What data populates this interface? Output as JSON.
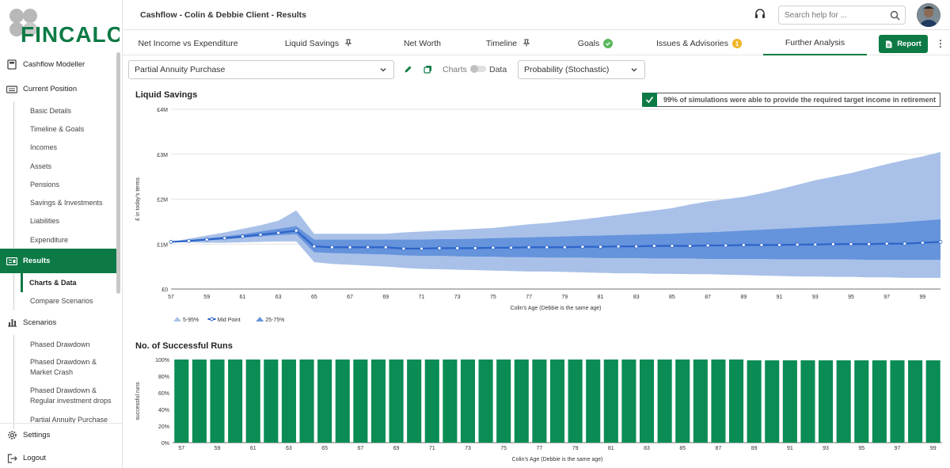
{
  "brand": {
    "logo_text": "FINCALC",
    "accent": "#0d7a45"
  },
  "header": {
    "title": "Cashflow - Colin & Debbie Client - Results",
    "search_placeholder": "Search help for ..."
  },
  "sidebar": {
    "items": [
      {
        "label": "Cashflow Modeller",
        "icon": "calculator-icon"
      },
      {
        "label": "Current Position",
        "icon": "keyboard-icon"
      }
    ],
    "current_position_sub": [
      "Basic Details",
      "Timeline & Goals",
      "Incomes",
      "Assets",
      "Pensions",
      "Savings & Investments",
      "Liabilities",
      "Expenditure"
    ],
    "results": {
      "label": "Results",
      "icon": "results-icon"
    },
    "results_sub": [
      "Charts & Data",
      "Compare Scenarios"
    ],
    "scenarios": {
      "label": "Scenarios",
      "icon": "bar-chart-icon"
    },
    "scenarios_sub": [
      "Phased Drawdown",
      "Phased Drawdown & Market Crash",
      "Phased Drawdown & Regular investment drops",
      "Partial Annuity Purchase"
    ],
    "settings": "Settings",
    "logout": "Logout"
  },
  "tabs": [
    {
      "label": "Net Income vs Expenditure"
    },
    {
      "label": "Liquid Savings",
      "pinned": true
    },
    {
      "label": "Net Worth"
    },
    {
      "label": "Timeline",
      "pinned": true
    },
    {
      "label": "Goals",
      "badge": "check"
    },
    {
      "label": "Issues & Advisories",
      "badge": "1"
    },
    {
      "label": "Further Analysis",
      "active": true
    }
  ],
  "report_label": "Report",
  "toolbar": {
    "scenario": "Partial Annuity Purchase",
    "charts_label": "Charts",
    "data_label": "Data",
    "mode": "Probability (Stochastic)"
  },
  "chart1": {
    "title": "Liquid Savings",
    "banner": "99% of simulations were able to provide the required target income in retirement"
  },
  "chart2": {
    "title": "No. of Successful Runs"
  },
  "chart_data": [
    {
      "type": "area",
      "title": "Liquid Savings",
      "xlabel": "Colin's Age (Debbie is the same age)",
      "ylabel": "£ in today's terms",
      "yticks": [
        "£0",
        "£1M",
        "£2M",
        "£3M",
        "£4M"
      ],
      "ylim": [
        0,
        4000000
      ],
      "xlim": [
        57,
        100
      ],
      "x_tick_labels": [
        57,
        59,
        61,
        63,
        65,
        67,
        69,
        71,
        73,
        75,
        77,
        79,
        81,
        83,
        85,
        87,
        89,
        91,
        93,
        95,
        97,
        99
      ],
      "legend": [
        "5-95%",
        "Mid Point",
        "25-75%"
      ],
      "legend_position": "bottom-left",
      "x": [
        57,
        58,
        59,
        60,
        61,
        62,
        63,
        64,
        65,
        66,
        67,
        68,
        69,
        70,
        71,
        72,
        73,
        74,
        75,
        76,
        77,
        78,
        79,
        80,
        81,
        82,
        83,
        84,
        85,
        86,
        87,
        88,
        89,
        90,
        91,
        92,
        93,
        94,
        95,
        96,
        97,
        98,
        99,
        100
      ],
      "series": [
        {
          "name": "Mid Point",
          "values": [
            1.05,
            1.07,
            1.1,
            1.13,
            1.17,
            1.21,
            1.25,
            1.3,
            0.95,
            0.93,
            0.93,
            0.93,
            0.93,
            0.9,
            0.9,
            0.91,
            0.91,
            0.91,
            0.92,
            0.92,
            0.93,
            0.93,
            0.93,
            0.94,
            0.94,
            0.95,
            0.95,
            0.96,
            0.96,
            0.96,
            0.97,
            0.97,
            0.98,
            0.98,
            0.98,
            0.99,
            0.99,
            1.0,
            1.0,
            1.0,
            1.01,
            1.01,
            1.03,
            1.05
          ],
          "unit": "£M"
        },
        {
          "name": "25-75%",
          "low": [
            1.05,
            1.07,
            1.09,
            1.11,
            1.14,
            1.17,
            1.2,
            1.22,
            0.82,
            0.8,
            0.79,
            0.78,
            0.77,
            0.75,
            0.74,
            0.74,
            0.73,
            0.72,
            0.72,
            0.71,
            0.71,
            0.7,
            0.7,
            0.7,
            0.69,
            0.69,
            0.69,
            0.68,
            0.68,
            0.68,
            0.67,
            0.67,
            0.67,
            0.67,
            0.66,
            0.66,
            0.66,
            0.66,
            0.66,
            0.65,
            0.65,
            0.65,
            0.65,
            0.65
          ],
          "high": [
            1.05,
            1.09,
            1.13,
            1.17,
            1.22,
            1.28,
            1.34,
            1.4,
            1.1,
            1.1,
            1.1,
            1.1,
            1.1,
            1.1,
            1.1,
            1.11,
            1.11,
            1.12,
            1.13,
            1.14,
            1.15,
            1.16,
            1.17,
            1.18,
            1.19,
            1.2,
            1.21,
            1.22,
            1.23,
            1.25,
            1.26,
            1.28,
            1.3,
            1.32,
            1.34,
            1.36,
            1.38,
            1.4,
            1.42,
            1.44,
            1.46,
            1.49,
            1.52,
            1.55
          ],
          "unit": "£M"
        },
        {
          "name": "5-95%",
          "low": [
            1.05,
            1.04,
            1.03,
            1.03,
            1.04,
            1.05,
            1.06,
            1.06,
            0.6,
            0.56,
            0.54,
            0.52,
            0.5,
            0.47,
            0.45,
            0.44,
            0.43,
            0.42,
            0.41,
            0.4,
            0.39,
            0.39,
            0.38,
            0.37,
            0.36,
            0.35,
            0.35,
            0.34,
            0.34,
            0.33,
            0.33,
            0.32,
            0.31,
            0.3,
            0.29,
            0.28,
            0.28,
            0.27,
            0.27,
            0.26,
            0.26,
            0.25,
            0.25,
            0.25
          ],
          "high": [
            1.05,
            1.12,
            1.19,
            1.26,
            1.34,
            1.42,
            1.52,
            1.75,
            1.23,
            1.23,
            1.23,
            1.23,
            1.23,
            1.26,
            1.28,
            1.3,
            1.32,
            1.34,
            1.36,
            1.4,
            1.44,
            1.47,
            1.51,
            1.55,
            1.6,
            1.65,
            1.7,
            1.75,
            1.8,
            1.88,
            1.95,
            2.0,
            2.05,
            2.13,
            2.22,
            2.32,
            2.42,
            2.5,
            2.58,
            2.68,
            2.78,
            2.87,
            2.95,
            3.05
          ],
          "unit": "£M"
        }
      ]
    },
    {
      "type": "bar",
      "title": "No. of Successful Runs",
      "xlabel": "Colin's Age (Debbie is the same age)",
      "ylabel": "successful runs",
      "yticks": [
        "0%",
        "20%",
        "40%",
        "60%",
        "80%",
        "100%"
      ],
      "ylim": [
        0,
        100
      ],
      "x_tick_labels": [
        57,
        59,
        61,
        63,
        65,
        67,
        69,
        71,
        73,
        75,
        77,
        79,
        81,
        83,
        85,
        87,
        89,
        91,
        93,
        95,
        97,
        99
      ],
      "categories": [
        57,
        58,
        59,
        60,
        61,
        62,
        63,
        64,
        65,
        66,
        67,
        68,
        69,
        70,
        71,
        72,
        73,
        74,
        75,
        76,
        77,
        78,
        79,
        80,
        81,
        82,
        83,
        84,
        85,
        86,
        87,
        88,
        89,
        90,
        91,
        92,
        93,
        94,
        95,
        96,
        97,
        98,
        99
      ],
      "values": [
        100,
        100,
        100,
        100,
        100,
        100,
        100,
        100,
        100,
        100,
        100,
        100,
        100,
        100,
        100,
        100,
        100,
        100,
        100,
        100,
        100,
        100,
        100,
        100,
        100,
        100,
        100,
        100,
        100,
        100,
        100,
        100,
        99,
        99,
        99,
        99,
        99,
        99,
        99,
        99,
        99,
        99,
        99
      ],
      "color": "#0a8c54"
    }
  ]
}
